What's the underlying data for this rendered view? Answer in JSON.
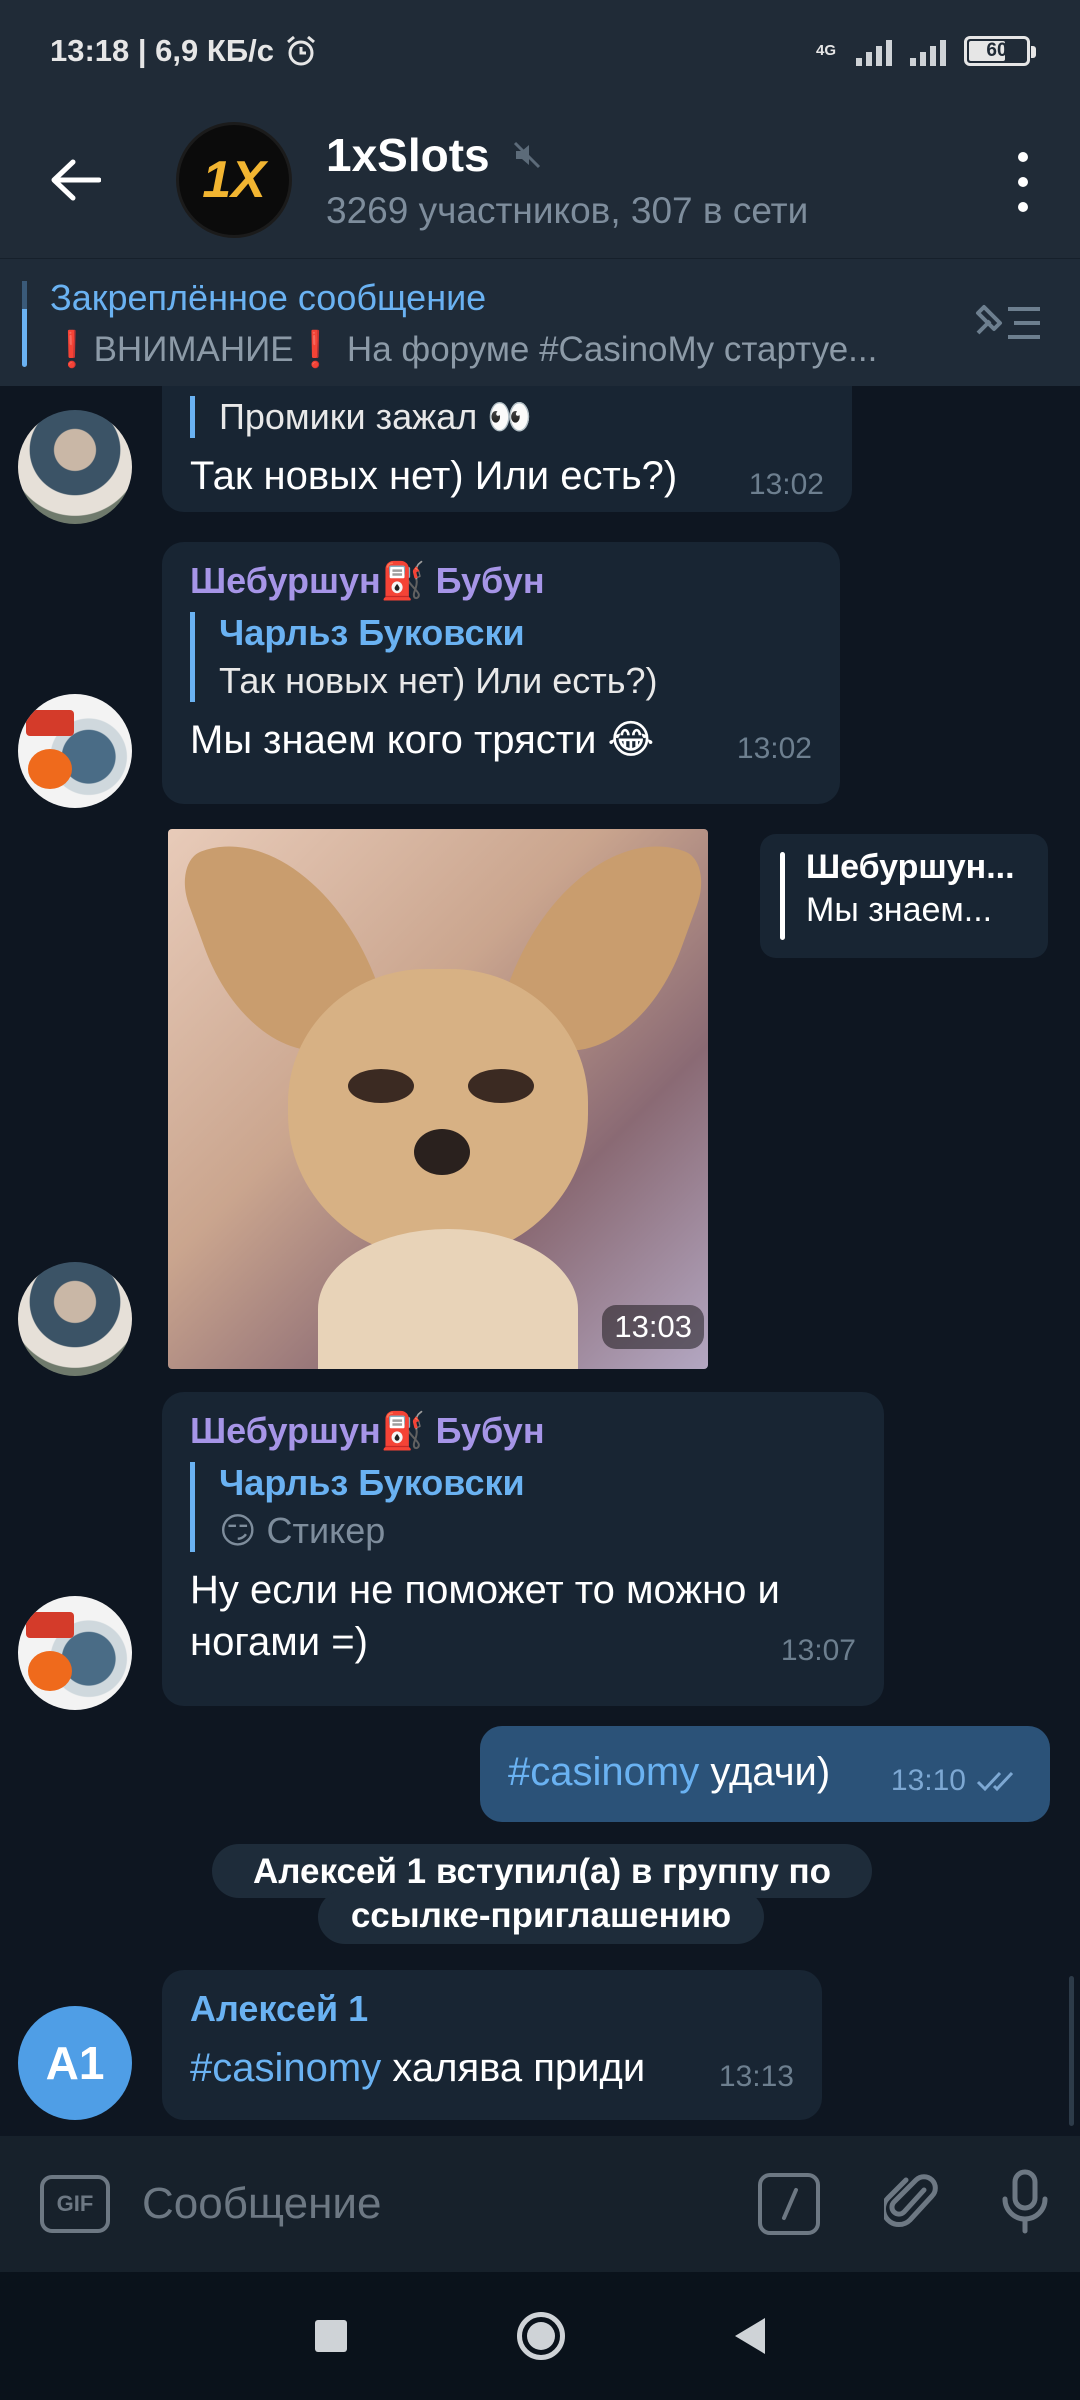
{
  "status_bar": {
    "time": "13:18 | 6,9 КБ/с",
    "network": "4G",
    "battery": "60"
  },
  "header": {
    "avatar_text": "1X",
    "title": "1xSlots",
    "subtitle": "3269 участников, 307 в сети"
  },
  "pinned": {
    "title": "Закреплённое сообщение",
    "text": "❗ВНИМАНИЕ❗ На форуме #CasinoMy стартуе..."
  },
  "messages": [
    {
      "text": "Так новых нет) Или есть?)",
      "reply_text": "Промики зажал 👀",
      "time": "13:02"
    },
    {
      "sender": "Шебуршун⛽ Бубун",
      "reply_name": "Чарльз Буковски",
      "reply_text": "Так новых нет) Или есть?)",
      "text": "Мы знаем кого трясти 😂",
      "time": "13:02"
    },
    {
      "photo_time": "13:03",
      "reply_name": "Шебуршун...",
      "reply_text": "Мы знаем..."
    },
    {
      "sender": "Шебуршун⛽ Бубун",
      "reply_name": "Чарльз Буковски",
      "reply_text": "😏 Стикер",
      "text_line1": "Ну если не поможет то можно и",
      "text_line2": "ногами =)",
      "time": "13:07"
    },
    {
      "hashtag": "#casinomy",
      "text": " удачи)",
      "time": "13:10"
    },
    {
      "service_line1": "Алексей 1 вступил(а) в группу по",
      "service_line2": "ссылке-приглашению"
    },
    {
      "avatar_text": "А1",
      "sender": "Алексей 1",
      "hashtag": "#casinomy",
      "text": " халява приди",
      "time": "13:13"
    }
  ],
  "input": {
    "gif_label": "GIF",
    "placeholder": "Сообщение"
  },
  "colors": {
    "background": "#0e1621",
    "header": "#202b37",
    "bubble_in": "#182533",
    "bubble_out": "#2b5278",
    "accent": "#6ab2f2",
    "sender_purple": "#a695e7"
  }
}
